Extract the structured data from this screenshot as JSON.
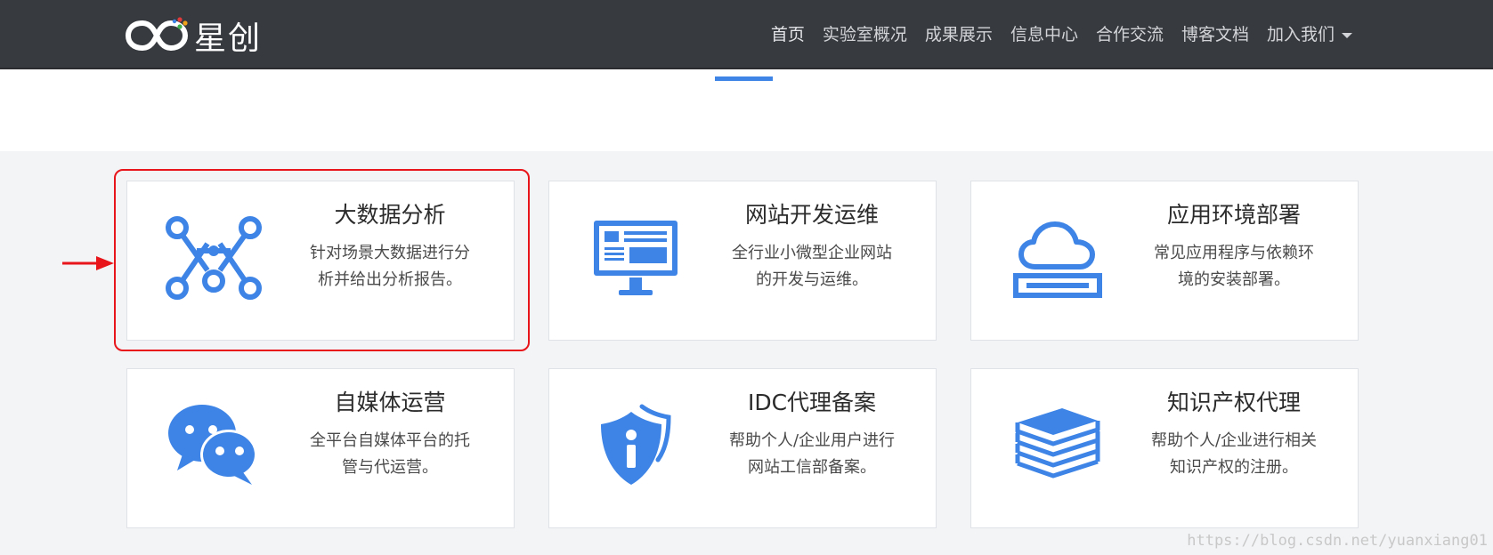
{
  "brand": {
    "name": "星创"
  },
  "nav": {
    "items": [
      {
        "label": "首页",
        "active": true
      },
      {
        "label": "实验室概况"
      },
      {
        "label": "成果展示"
      },
      {
        "label": "信息中心"
      },
      {
        "label": "合作交流"
      },
      {
        "label": "博客文档"
      },
      {
        "label": "加入我们",
        "dropdown": true
      }
    ]
  },
  "cards": [
    {
      "title": "大数据分析",
      "desc_line1": "针对场景大数据进行分",
      "desc_line2": "析并给出分析报告。",
      "icon": "network-graph-icon"
    },
    {
      "title": "网站开发运维",
      "desc_line1": "全行业小微型企业网站",
      "desc_line2": "的开发与运维。",
      "icon": "monitor-icon"
    },
    {
      "title": "应用环境部署",
      "desc_line1": "常见应用程序与依赖环",
      "desc_line2": "境的安装部署。",
      "icon": "cloud-server-icon"
    },
    {
      "title": "自媒体运营",
      "desc_line1": "全平台自媒体平台的托",
      "desc_line2": "管与代运营。",
      "icon": "chat-bubbles-icon"
    },
    {
      "title": "IDC代理备案",
      "desc_line1": "帮助个人/企业用户进行",
      "desc_line2": "网站工信部备案。",
      "icon": "shield-info-icon"
    },
    {
      "title": "知识产权代理",
      "desc_line1": "帮助个人/企业进行相关",
      "desc_line2": "知识产权的注册。",
      "icon": "books-icon"
    }
  ],
  "watermark": "https://blog.csdn.net/yuanxiang01",
  "colors": {
    "navbar": "#373a3f",
    "accent": "#3d84e6",
    "highlight": "#e8151b",
    "content_bg": "#f3f4f6"
  }
}
